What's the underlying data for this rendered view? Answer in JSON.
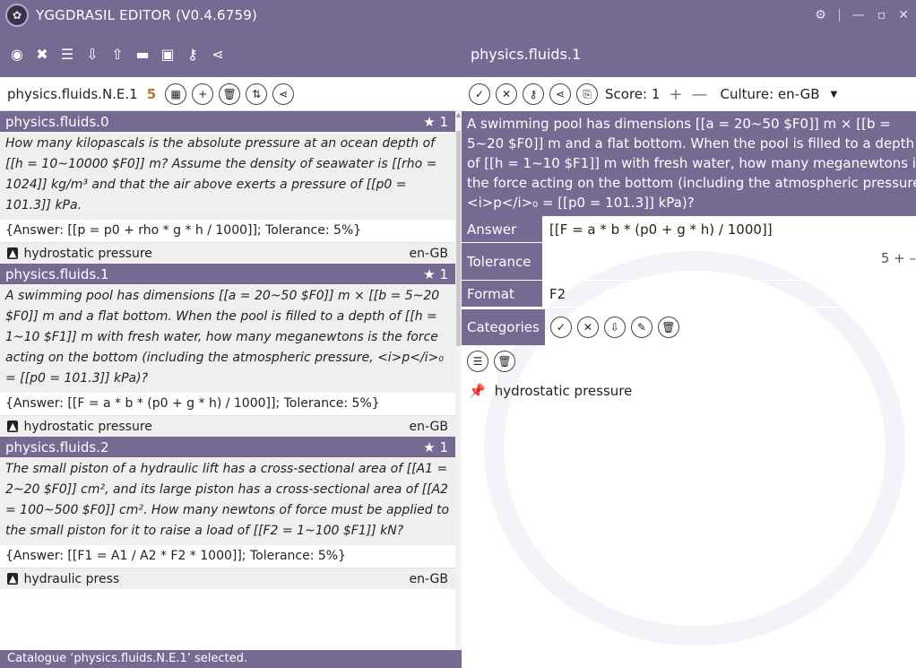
{
  "app": {
    "title": "YGGDRASIL EDITOR (V0.4.6759)"
  },
  "toolbar_icons": [
    "eye-icon",
    "close-icon",
    "list-icon",
    "import-icon",
    "export-icon",
    "folder-icon",
    "save-icon",
    "key-icon",
    "share-icon"
  ],
  "catalog": {
    "name": "physics.fluids.N.E.1",
    "count": "5"
  },
  "items": [
    {
      "id": "physics.fluids.0",
      "rating": "1",
      "question": "How many kilopascals is the absolute pressure at an ocean depth of [[h = 10~10000 $F0]] m? Assume the density of seawater is [[rho = 1024]] kg/m³ and that the air above exerts a pressure of [[p0 = 101.3]] kPa.",
      "answer": "{Answer: [[p = p0 + rho * g * h / 1000]]; Tolerance: 5%}",
      "category": "hydrostatic pressure",
      "culture": "en-GB"
    },
    {
      "id": "physics.fluids.1",
      "rating": "1",
      "question": "A swimming pool has dimensions [[a = 20~50 $F0]] m × [[b = 5~20 $F0]] m and a flat bottom. When the pool is filled to a depth of [[h = 1~10 $F1]] m with fresh water, how many meganewtons is the force acting on the bottom (including the atmospheric pressure, <i>p</i>₀ = [[p0 = 101.3]] kPa)?",
      "answer": "{Answer: [[F = a * b * (p0 + g * h) / 1000]]; Tolerance: 5%}",
      "category": "hydrostatic pressure",
      "culture": "en-GB"
    },
    {
      "id": "physics.fluids.2",
      "rating": "1",
      "question": "The small piston of a hydraulic lift has a cross-sectional area of [[A1 = 2~20 $F0]] cm², and its large piston has a cross-sectional area of [[A2 = 100~500 $F0]] cm². How many newtons of force must be applied to the small piston for it to raise a load of [[F2 = 1~100 $F1]] kN?",
      "answer": "{Answer: [[F1 = A1 / A2 * F2 * 1000]]; Tolerance: 5%}",
      "category": "hydraulic press",
      "culture": "en-GB"
    }
  ],
  "status": "Catalogue ‘physics.fluids.N.E.1’ selected.",
  "detail": {
    "title": "physics.fluids.1",
    "score_label": "Score: 1",
    "culture_label": "Culture: en-GB",
    "question": "A swimming pool has dimensions [[a = 20~50 $F0]] m × [[b = 5~20 $F0]] m and a flat bottom. When the pool is filled to a depth of [[h = 1~10 $F1]] m with fresh water, how many meganewtons is the force acting on the bottom (including the atmospheric pressure, <i>p</i>₀ = [[p0 = 101.3]] kPa)?",
    "answer_label": "Answer",
    "answer_value": "[[F = a * b * (p0 + g * h) / 1000]]",
    "tolerance_label": "Tolerance",
    "tolerance_value": "5",
    "format_label": "Format",
    "format_value": "F2",
    "categories_label": "Categories",
    "category_entry": "hydrostatic pressure"
  },
  "colors": {
    "accent": "#766a93",
    "star": "#ffffff",
    "count": "#b07a2a"
  }
}
